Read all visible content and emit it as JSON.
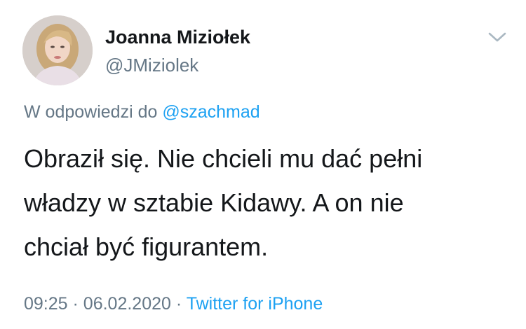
{
  "author": {
    "display_name": "Joanna Miziołek",
    "handle": "@JMiziolek",
    "avatar_icon": "profile-photo"
  },
  "reply": {
    "prefix": "W odpowiedzi do",
    "to_handle": "@szachmad"
  },
  "tweet": {
    "lines": [
      "Obraził się. Nie chcieli mu dać pełni",
      "władzy w sztabie Kidawy. A on nie",
      "chciał być figurantem."
    ]
  },
  "meta": {
    "time": "09:25",
    "separator": "·",
    "date": "06.02.2020",
    "source": "Twitter for iPhone"
  },
  "menu": {
    "icon": "chevron-down-icon"
  },
  "colors": {
    "text": "#14171a",
    "secondary": "#657786",
    "link": "#1da1f2",
    "background": "#ffffff"
  }
}
